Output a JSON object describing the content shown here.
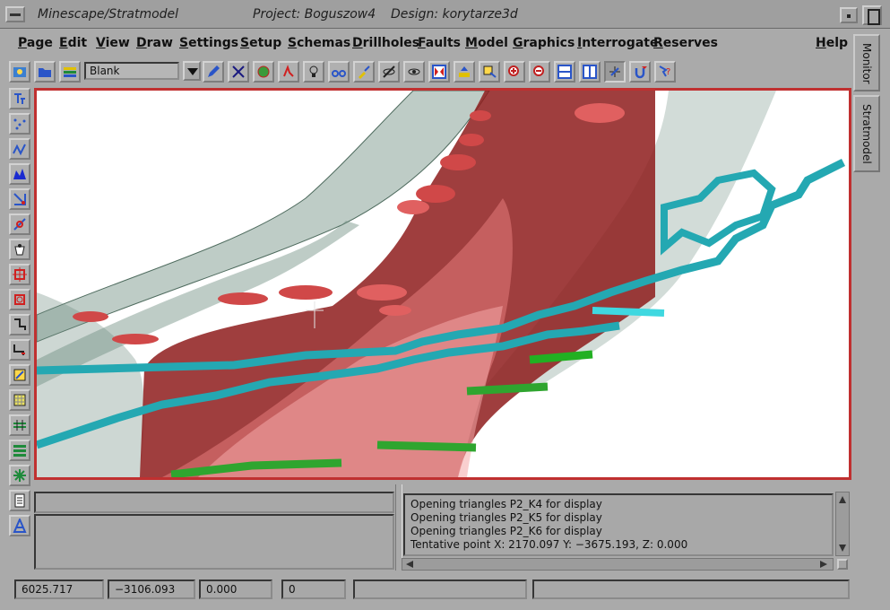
{
  "window": {
    "app_title": "Minescape/Stratmodel",
    "project": "Project: Boguszow4",
    "design": "Design: korytarze3d"
  },
  "menubar": {
    "items": [
      "Page",
      "Edit",
      "View",
      "Draw",
      "Settings",
      "Setup",
      "Schemas",
      "Drillholes",
      "Faults",
      "Model",
      "Graphics",
      "Interrogate",
      "Reserves"
    ],
    "help": "Help"
  },
  "toolbar": {
    "layer_value": "Blank",
    "icons": [
      "open-design-icon",
      "open-folder-icon",
      "layers-icon",
      "pencil-icon",
      "delete-tool-icon",
      "globe-icon",
      "pdf-icon",
      "lamp-icon",
      "binoculars-icon",
      "brush-icon",
      "hide-icon",
      "show-icon",
      "zoom-extents-icon",
      "export-icon",
      "select-window-icon",
      "zoom-in-icon",
      "zoom-out-icon",
      "horizontal-split-icon",
      "vertical-split-icon",
      "cursor-mode-icon",
      "undo-icon",
      "help-cursor-icon"
    ]
  },
  "side_toolbar": {
    "icons": [
      "text-tool-icon",
      "points-tool-icon",
      "polyline-tool-icon",
      "fill-tool-icon",
      "snap-tool-icon",
      "measure-tool-icon",
      "bucket-tool-icon",
      "box-select-icon",
      "box-deselect-icon",
      "corner-tool-icon",
      "step-tool-icon",
      "pattern-tool-icon",
      "hatch-tool-icon",
      "grid-tool-icon",
      "stack-tool-icon",
      "star-tool-icon",
      "report-tool-icon",
      "triangle-tool-icon"
    ]
  },
  "side_tabs": {
    "monitor": "Monitor",
    "stratmodel": "Stratmodel"
  },
  "messages": [
    "Opening triangles P2_K4 for display",
    "Opening triangles P2_K5 for display",
    "Opening triangles P2_K6 for display",
    "Tentative point X: 2170.097 Y: −3675.193, Z: 0.000"
  ],
  "statusbar": {
    "x": "6025.717",
    "y": "−3106.093",
    "z": "0.000",
    "count": "0",
    "field5": "",
    "field6": ""
  },
  "colors": {
    "viewport_border": "#c03030",
    "strata_red": "#b02828",
    "coal_cyan": "#2ab7c0",
    "coal_green": "#2fa52f",
    "surface_grey": "#7e9a8e"
  }
}
